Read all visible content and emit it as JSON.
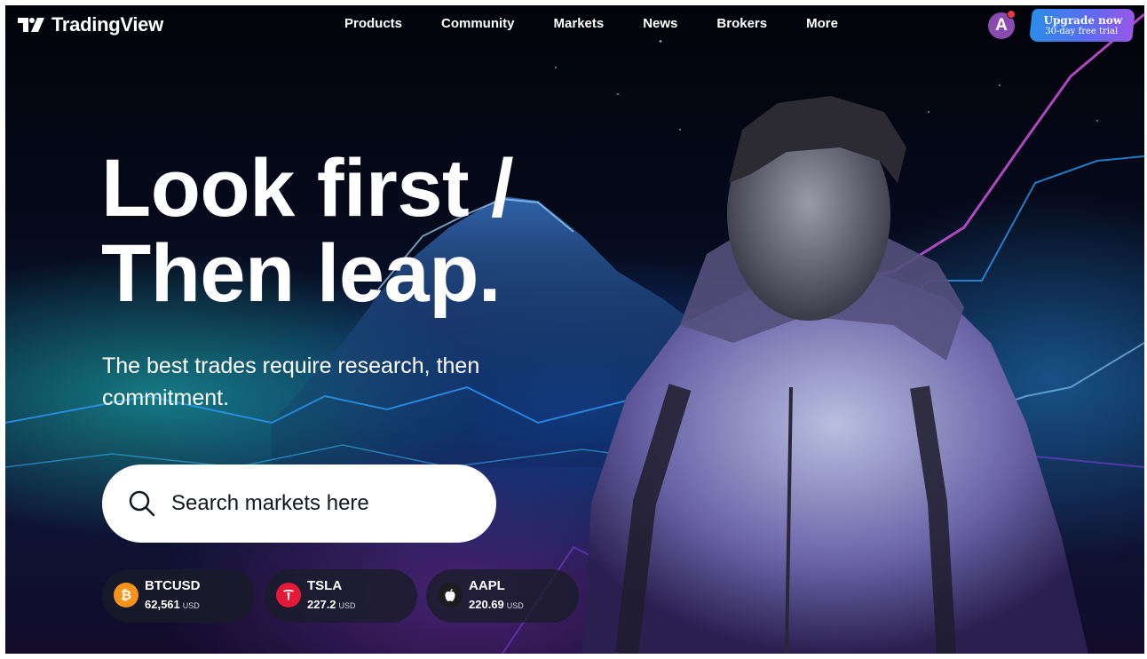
{
  "header": {
    "logo_text": "TradingView",
    "nav": [
      "Products",
      "Community",
      "Markets",
      "News",
      "Brokers",
      "More"
    ],
    "avatar_letter": "A",
    "upgrade": {
      "title": "Upgrade now",
      "subtitle": "30-day free trial"
    }
  },
  "hero": {
    "title_line1": "Look first /",
    "title_line2": "Then leap.",
    "subtitle_line1": "The best trades require research, then",
    "subtitle_line2": "commitment."
  },
  "search": {
    "placeholder": "Search markets here"
  },
  "tickers": [
    {
      "symbol": "BTCUSD",
      "value": "62,561",
      "unit": "USD",
      "icon": "bitcoin-icon",
      "color": "#f7931a"
    },
    {
      "symbol": "TSLA",
      "value": "227.2",
      "unit": "USD",
      "icon": "tesla-icon",
      "color": "#e31937"
    },
    {
      "symbol": "AAPL",
      "value": "220.69",
      "unit": "USD",
      "icon": "apple-icon",
      "color": "#1c1c1e"
    }
  ],
  "colors": {
    "background": "#03040a",
    "accent_blue": "#2b8de8",
    "accent_purple": "#9a57e8",
    "notification": "#f23645",
    "avatar": "#8a4bb0"
  }
}
